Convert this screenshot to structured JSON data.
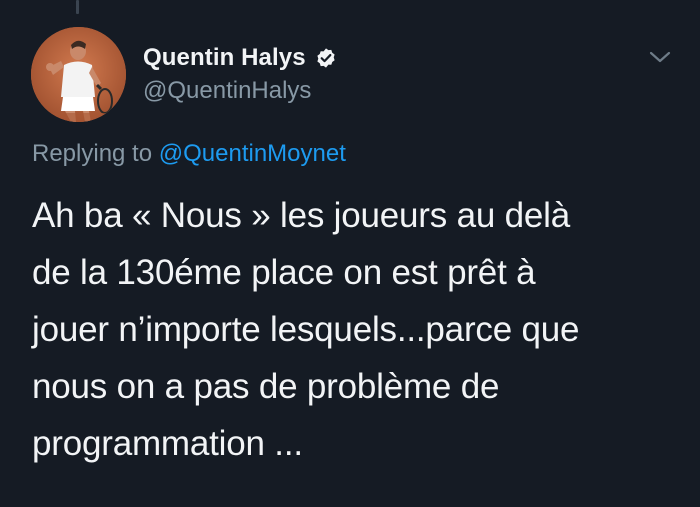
{
  "tweet": {
    "author": {
      "display_name": "Quentin Halys",
      "handle": "@QuentinHalys",
      "verified": true
    },
    "reply": {
      "prefix": "Replying to",
      "mention": "@QuentinMoynet"
    },
    "text_lines": [
      "Ah ba « Nous » les joueurs au delà",
      "de la 130éme place on est prêt à",
      "jouer n’importe lesquels...parce que",
      "nous on a pas de problème de",
      "programmation ..."
    ]
  },
  "icons": {
    "verified": "verified-badge-icon",
    "menu": "chevron-down-icon"
  },
  "colors": {
    "background": "#151b24",
    "text_primary": "#f2f4f6",
    "text_secondary": "#8899a6",
    "accent": "#1d9bf0"
  }
}
